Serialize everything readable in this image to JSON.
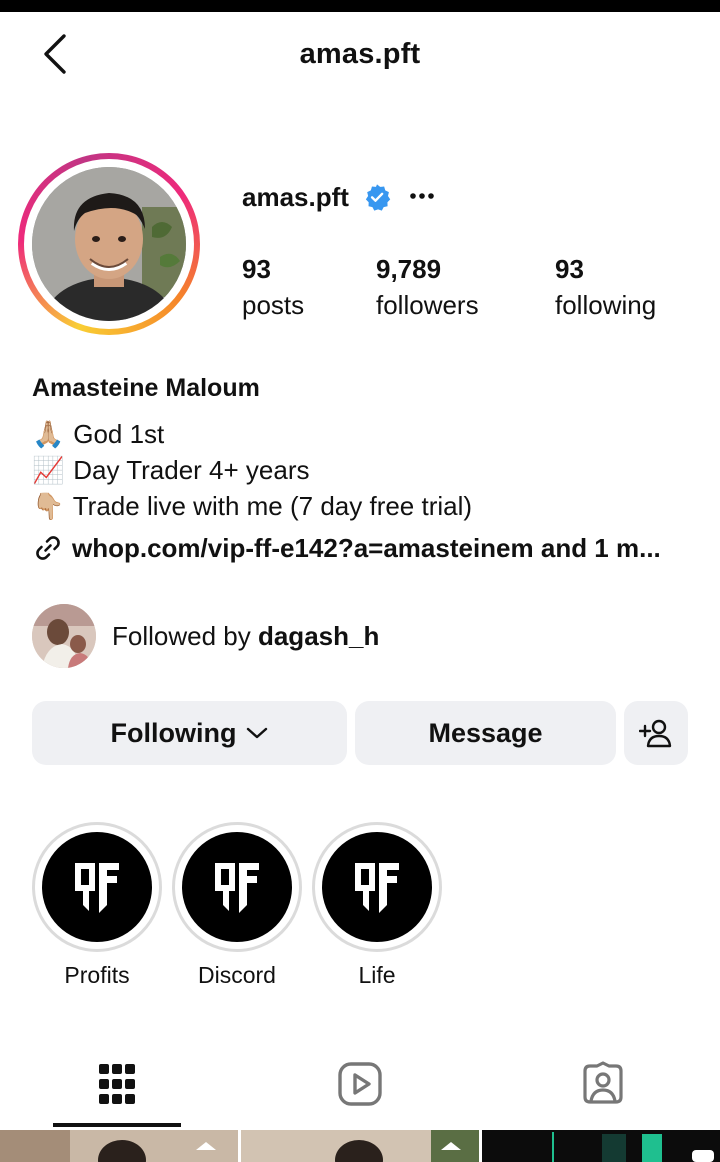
{
  "header": {
    "title": "amas.pft"
  },
  "profile": {
    "username": "amas.pft",
    "full_name": "Amasteine Maloum",
    "stats": {
      "posts_count": "93",
      "posts_label": "posts",
      "followers_count": "9,789",
      "followers_label": "followers",
      "following_count": "93",
      "following_label": "following"
    },
    "bio_lines": [
      {
        "emoji": "🙏🏼",
        "text": "God 1st"
      },
      {
        "emoji": "📈",
        "text": "Day Trader 4+ years"
      },
      {
        "emoji": "👇🏼",
        "text": "Trade live with me (7 day free trial)"
      }
    ],
    "link_text": "whop.com/vip-ff-e142?a=amasteinem and 1 m...",
    "followed_by_prefix": "Followed by ",
    "followed_by_user": "dagash_h"
  },
  "actions": {
    "following_label": "Following",
    "message_label": "Message"
  },
  "highlights": [
    {
      "label": "Profits"
    },
    {
      "label": "Discord"
    },
    {
      "label": "Life"
    }
  ],
  "colors": {
    "verified_blue": "#3897f0",
    "button_bg": "#eff0f3",
    "ring_gradient": [
      "#f9ce34",
      "#ee2a7b",
      "#c13584",
      "#f58529"
    ]
  },
  "icons": {
    "back": "chevron-left-icon",
    "verified": "verified-badge-icon",
    "more": "more-horizontal-icon",
    "link": "link-icon",
    "add_user": "add-user-icon",
    "grid_tab": "grid-icon",
    "reels_tab": "reels-icon",
    "tagged_tab": "tagged-icon"
  }
}
